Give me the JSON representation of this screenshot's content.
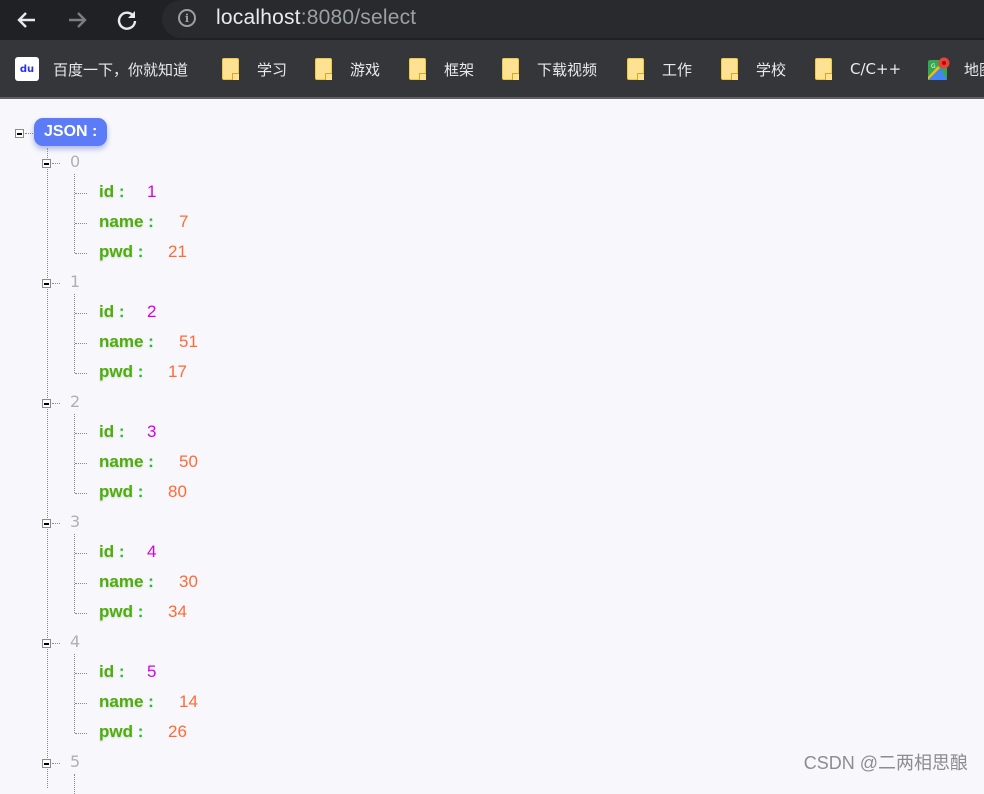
{
  "browser": {
    "url_host": "localhost",
    "url_rest": ":8080/select",
    "nav": {
      "back": "back-icon",
      "forward": "forward-icon",
      "reload": "reload-icon",
      "info": "info-icon"
    }
  },
  "bookmarks": [
    {
      "label": "百度一下，你就知道",
      "icon": "baidu-icon"
    },
    {
      "label": "学习",
      "icon": "folder-icon"
    },
    {
      "label": "游戏",
      "icon": "folder-icon"
    },
    {
      "label": "框架",
      "icon": "folder-icon"
    },
    {
      "label": "下载视频",
      "icon": "folder-icon"
    },
    {
      "label": "工作",
      "icon": "folder-icon"
    },
    {
      "label": "学校",
      "icon": "folder-icon"
    },
    {
      "label": "C/C++",
      "icon": "folder-icon"
    },
    {
      "label": "地图",
      "icon": "maps-icon"
    }
  ],
  "json_view": {
    "root_label": "JSON :",
    "records": [
      {
        "index": "0",
        "id": "1",
        "name": "7",
        "pwd": "21"
      },
      {
        "index": "1",
        "id": "2",
        "name": "51",
        "pwd": "17"
      },
      {
        "index": "2",
        "id": "3",
        "name": "50",
        "pwd": "80"
      },
      {
        "index": "3",
        "id": "4",
        "name": "30",
        "pwd": "34"
      },
      {
        "index": "4",
        "id": "5",
        "name": "14",
        "pwd": "26"
      },
      {
        "index": "5"
      }
    ],
    "keys": {
      "id": "id",
      "name": "name",
      "pwd": "pwd"
    },
    "colon": ":",
    "colors": {
      "key": "#4caf08",
      "number": "#d600e8",
      "string": "#ff6a35",
      "badge": "#5b7cf6"
    }
  },
  "watermark": "CSDN @二两相思酿"
}
